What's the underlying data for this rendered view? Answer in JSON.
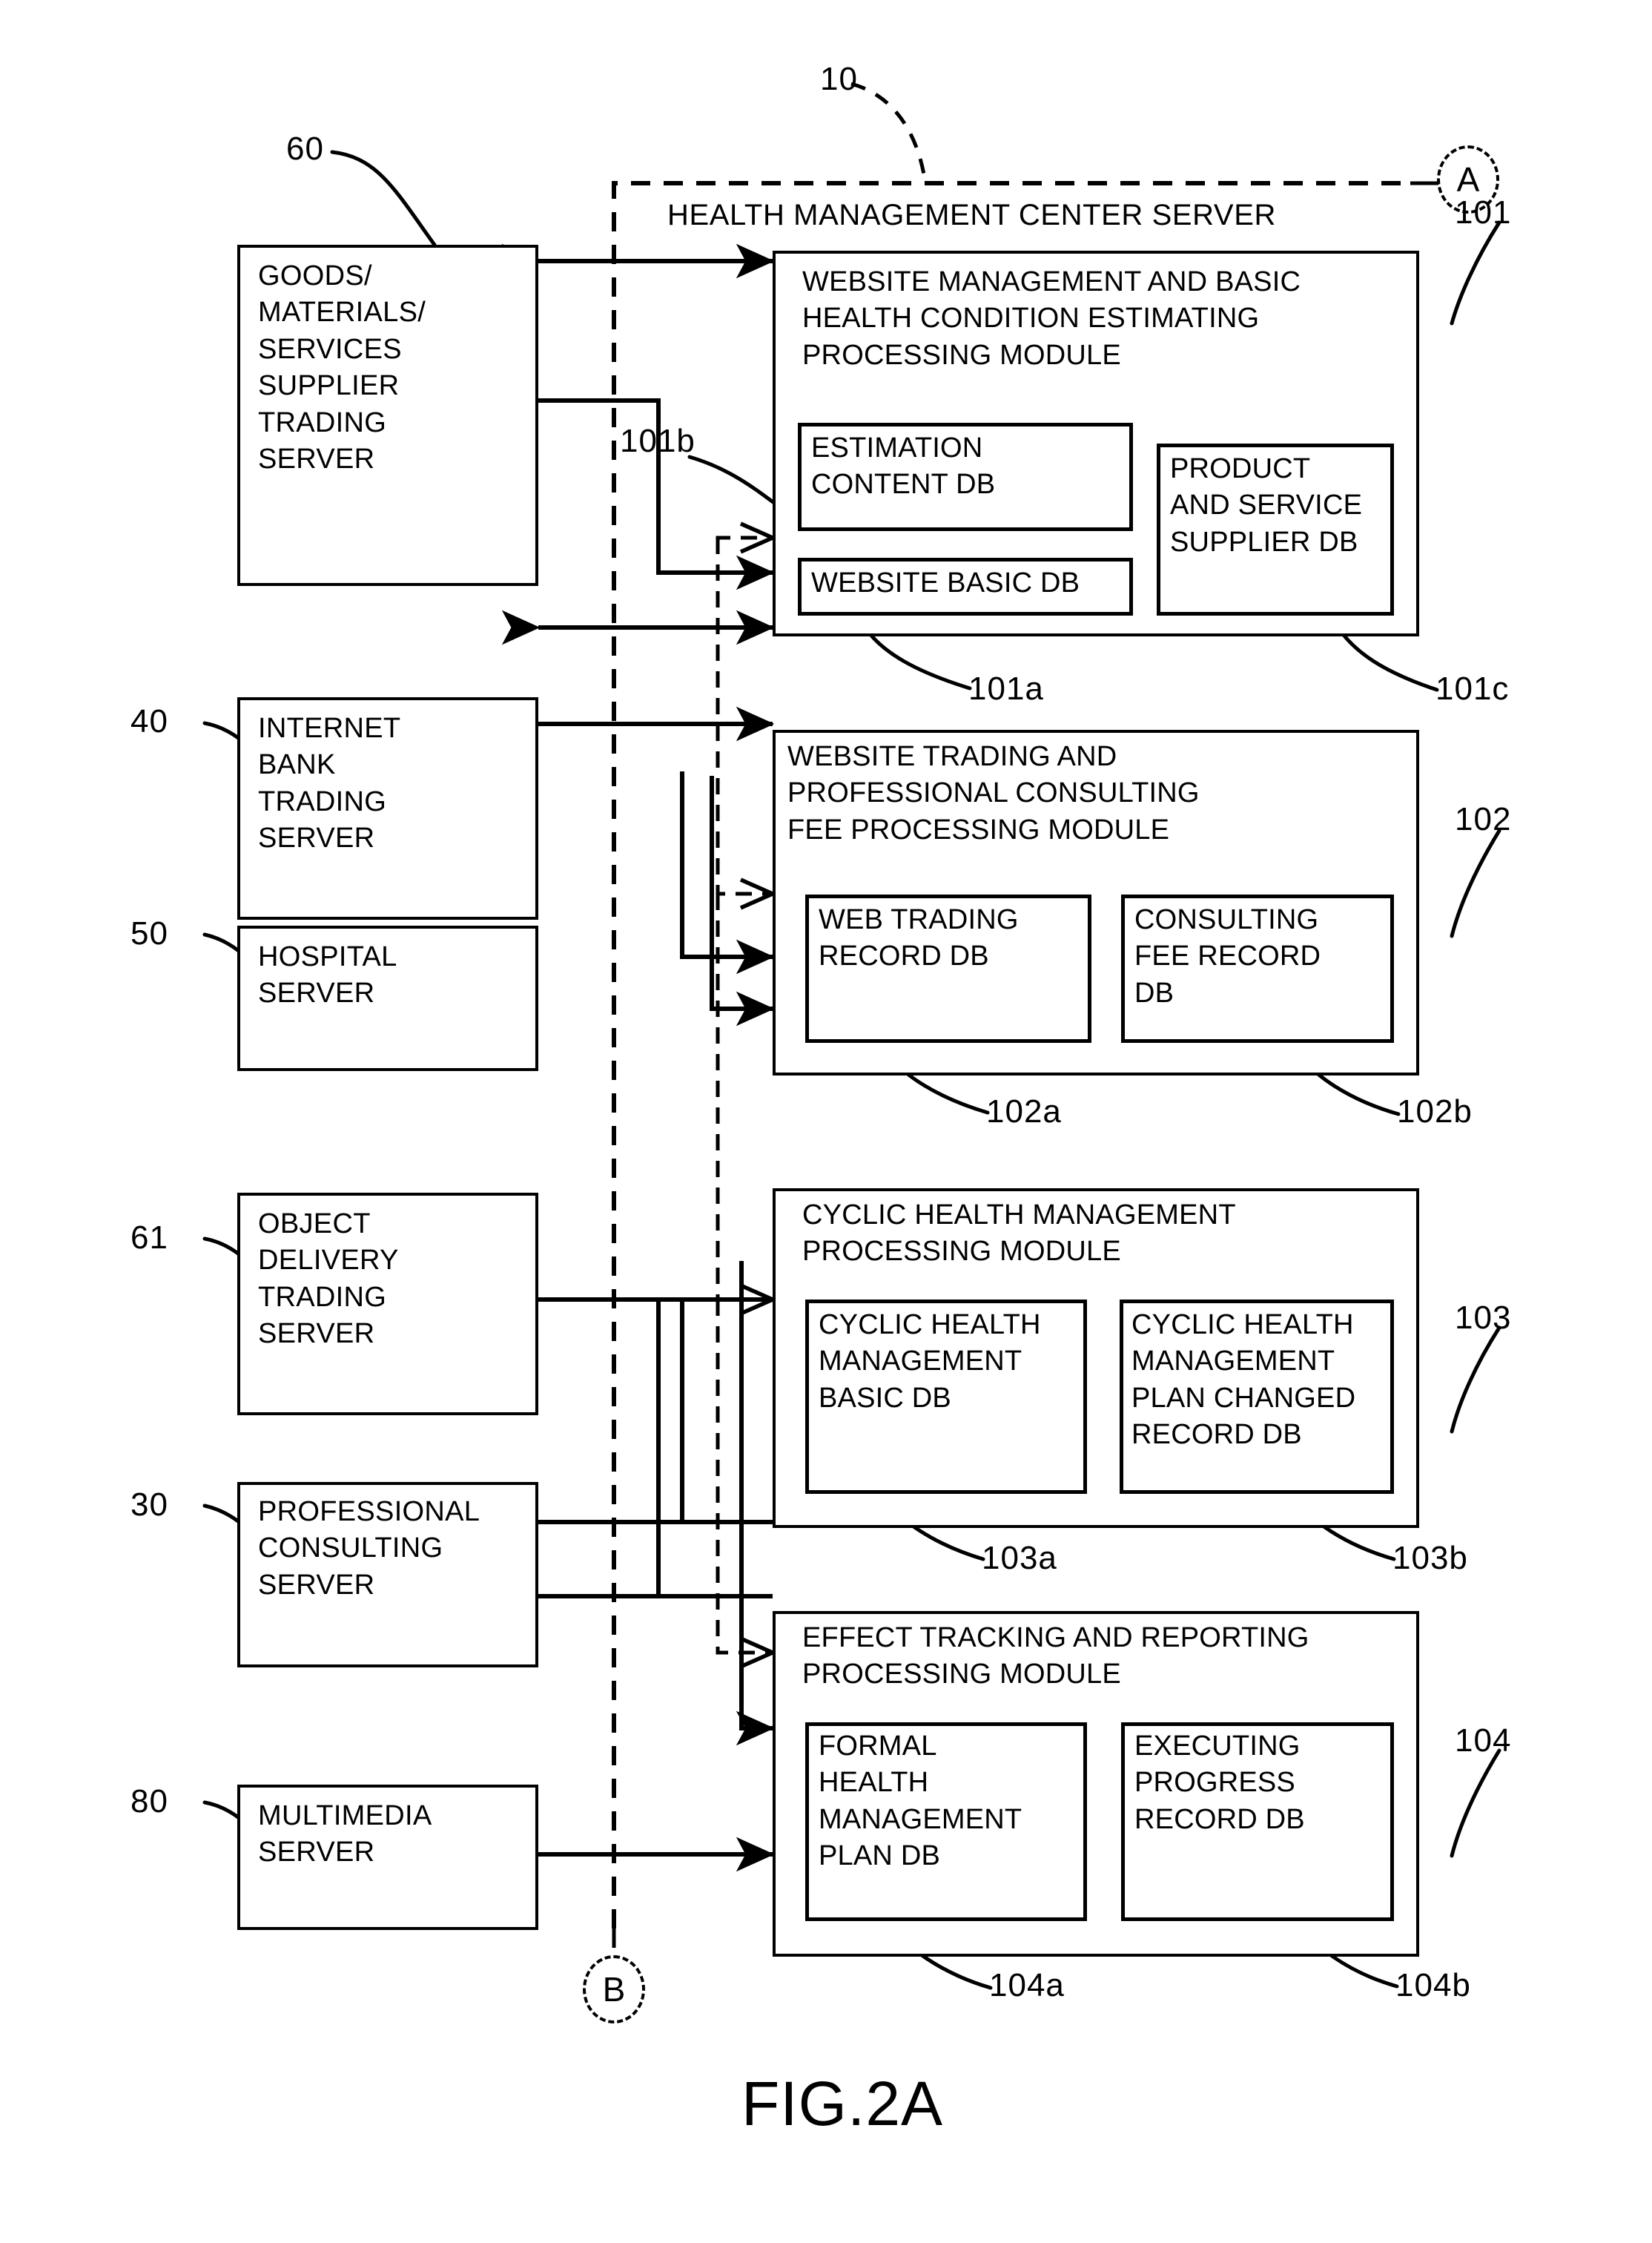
{
  "figure": {
    "caption": "FIG.2A",
    "system_ref": "10",
    "boundary_label": "HEALTH MANAGEMENT CENTER SERVER",
    "connector_a": "A",
    "connector_b": "B"
  },
  "external_servers": [
    {
      "ref": "60",
      "lines": [
        "GOODS/",
        "MATERIALS/",
        "SERVICES",
        "SUPPLIER",
        "TRADING",
        "SERVER"
      ]
    },
    {
      "ref": "40",
      "lines": [
        "INTERNET",
        "BANK",
        "TRADING",
        "SERVER"
      ]
    },
    {
      "ref": "50",
      "lines": [
        "HOSPITAL",
        "SERVER"
      ]
    },
    {
      "ref": "61",
      "lines": [
        "OBJECT",
        "DELIVERY",
        "TRADING",
        "SERVER"
      ]
    },
    {
      "ref": "30",
      "lines": [
        "PROFESSIONAL",
        "CONSULTING",
        "SERVER"
      ]
    },
    {
      "ref": "80",
      "lines": [
        "MULTIMEDIA",
        "SERVER"
      ]
    }
  ],
  "modules": [
    {
      "ref": "101",
      "title_lines": [
        "WEBSITE MANAGEMENT AND BASIC",
        "HEALTH CONDITION ESTIMATING",
        "PROCESSING MODULE"
      ],
      "databases": [
        {
          "ref": "101b",
          "lines": [
            "ESTIMATION",
            "CONTENT  DB"
          ]
        },
        {
          "ref": "101a",
          "lines": [
            "WEBSITE BASIC DB"
          ]
        },
        {
          "ref": "101c",
          "lines": [
            "PRODUCT",
            "AND SERVICE",
            "SUPPLIER DB"
          ]
        }
      ]
    },
    {
      "ref": "102",
      "title_lines": [
        "WEBSITE TRADING AND",
        "PROFESSIONAL CONSULTING",
        "FEE PROCESSING MODULE"
      ],
      "databases": [
        {
          "ref": "102a",
          "lines": [
            "WEB TRADING",
            "RECORD DB"
          ]
        },
        {
          "ref": "102b",
          "lines": [
            "CONSULTING",
            "FEE RECORD",
            "DB"
          ]
        }
      ]
    },
    {
      "ref": "103",
      "title_lines": [
        "CYCLIC HEALTH MANAGEMENT",
        "PROCESSING MODULE"
      ],
      "databases": [
        {
          "ref": "103a",
          "lines": [
            "CYCLIC HEALTH",
            "MANAGEMENT",
            "BASIC DB"
          ]
        },
        {
          "ref": "103b",
          "lines": [
            "CYCLIC HEALTH",
            "MANAGEMENT",
            "PLAN CHANGED",
            "RECORD DB"
          ]
        }
      ]
    },
    {
      "ref": "104",
      "title_lines": [
        "EFFECT TRACKING AND REPORTING",
        "PROCESSING MODULE"
      ],
      "databases": [
        {
          "ref": "104a",
          "lines": [
            "FORMAL",
            "HEALTH",
            "MANAGEMENT",
            "PLAN DB"
          ]
        },
        {
          "ref": "104b",
          "lines": [
            "EXECUTING",
            "PROGRESS",
            "RECORD DB"
          ]
        }
      ]
    }
  ],
  "colors": {
    "ink": "#000000",
    "paper": "#ffffff"
  }
}
